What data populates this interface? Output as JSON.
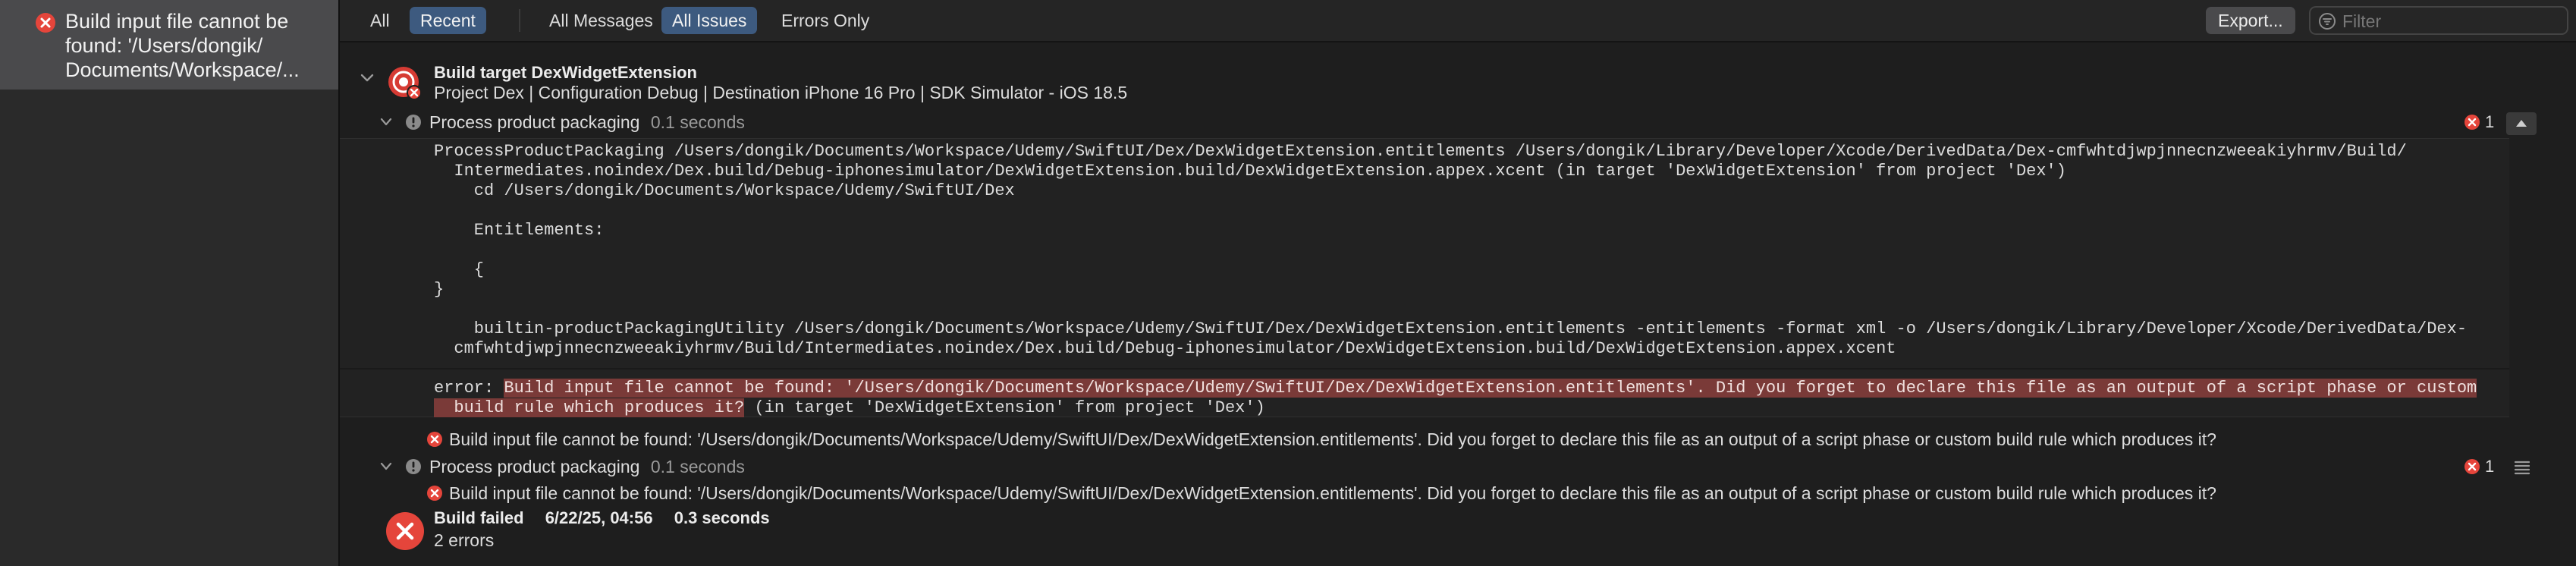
{
  "sidebar": {
    "issue": {
      "text_lines": [
        "Build input file cannot be",
        "found: '/Users/dongik/",
        "Documents/Workspace/..."
      ],
      "icon": "error-icon"
    }
  },
  "toolbar": {
    "scope_all": "All",
    "scope_recent": "Recent",
    "filter_all_messages": "All Messages",
    "filter_all_issues": "All Issues",
    "filter_errors_only": "Errors Only",
    "export_label": "Export...",
    "filter_placeholder": "Filter"
  },
  "build": {
    "target_title": "Build target DexWidgetExtension",
    "target_subtitle": "Project Dex | Configuration Debug | Destination iPhone 16 Pro | SDK Simulator - iOS 18.5",
    "step1": {
      "title": "Process product packaging",
      "duration": "0.1 seconds",
      "error_count": "1",
      "log_lines": [
        "ProcessProductPackaging /Users/dongik/Documents/Workspace/Udemy/SwiftUI/Dex/DexWidgetExtension.entitlements /Users/dongik/Library/Developer/Xcode/DerivedData/Dex-cmfwhtdjwpjnnecnzweeakiyhrmv/Build/",
        "  Intermediates.noindex/Dex.build/Debug-iphonesimulator/DexWidgetExtension.build/DexWidgetExtension.appex.xcent (in target 'DexWidgetExtension' from project 'Dex')",
        "    cd /Users/dongik/Documents/Workspace/Udemy/SwiftUI/Dex",
        "",
        "    Entitlements:",
        "",
        "    {",
        "}",
        "",
        "    builtin-productPackagingUtility /Users/dongik/Documents/Workspace/Udemy/SwiftUI/Dex/DexWidgetExtension.entitlements -entitlements -format xml -o /Users/dongik/Library/Developer/Xcode/DerivedData/Dex-",
        "  cmfwhtdjwpjnnecnzweeakiyhrmv/Build/Intermediates.noindex/Dex.build/Debug-iphonesimulator/DexWidgetExtension.build/DexWidgetExtension.appex.xcent"
      ],
      "error_prefix": "error: ",
      "error_highlight_1": "Build input file cannot be found: '/Users/dongik/Documents/Workspace/Udemy/SwiftUI/Dex/DexWidgetExtension.entitlements'. Did you forget to declare this file as an output of a script phase or custom",
      "error_highlight_2": "  build rule which produces it?",
      "error_suffix": " (in target 'DexWidgetExtension' from project 'Dex')",
      "issue_text": "Build input file cannot be found: '/Users/dongik/Documents/Workspace/Udemy/SwiftUI/Dex/DexWidgetExtension.entitlements'. Did you forget to declare this file as an output of a script phase or custom build rule which produces it?"
    },
    "step2": {
      "title": "Process product packaging",
      "duration": "0.1 seconds",
      "error_count": "1",
      "issue_text": "Build input file cannot be found: '/Users/dongik/Documents/Workspace/Udemy/SwiftUI/Dex/DexWidgetExtension.entitlements'. Did you forget to declare this file as an output of a script phase or custom build rule which produces it?"
    },
    "result": {
      "status": "Build failed",
      "date": "6/22/25, 04:56",
      "duration": "0.3 seconds",
      "errors": "2 errors"
    }
  },
  "colors": {
    "error_red": "#e5453b",
    "selected_blue": "#3d5a7f",
    "highlight": "#7a3a38"
  }
}
